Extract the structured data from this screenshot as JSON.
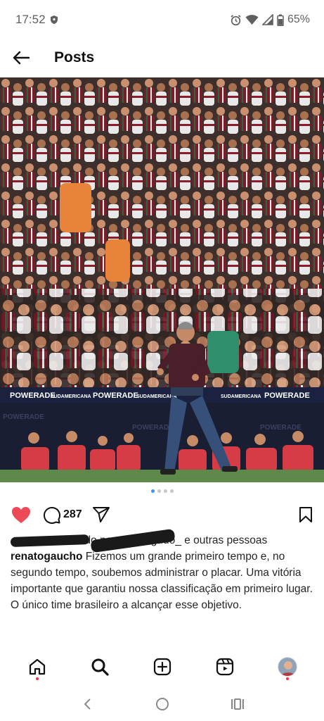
{
  "status_bar": {
    "time": "17:52",
    "battery": "65%",
    "icons": [
      "shield-icon",
      "alarm-icon",
      "wifi-icon",
      "signal-icon",
      "battery-icon"
    ]
  },
  "header": {
    "title": "Posts",
    "back_icon": "arrow-left-icon"
  },
  "post": {
    "image_alt": "Coach gesturing on the pitch in front of a stadium crowd",
    "ad_boards": [
      "POWERADE",
      "SUDAMERICANA",
      "POWERADE",
      "SUDAMERICANA",
      "POWERADE",
      "SUDAMERICANA",
      "POWERADE"
    ],
    "carousel": {
      "total": 4,
      "active": 1
    },
    "actions": {
      "liked": true,
      "comment_count": "287",
      "colors": {
        "like": "#ed4956",
        "active_dot": "#3897f0"
      }
    },
    "liked_by": {
      "partial_text": "urtido por",
      "partial_name": "gudo_",
      "suffix": "e outras pessoas"
    },
    "caption": {
      "username": "renatogaucho",
      "text": "Fizemos um grande primeiro tempo e, no segundo tempo, soubemos administrar o placar. Uma vitória importante que garantiu nossa classificação em primeiro lugar. O único time brasileiro a alcançar esse objetivo."
    }
  },
  "bottom_nav": {
    "items": [
      "home-icon",
      "search-icon",
      "create-icon",
      "reels-icon",
      "profile-avatar"
    ]
  },
  "system_nav": [
    "back",
    "home",
    "recents"
  ]
}
